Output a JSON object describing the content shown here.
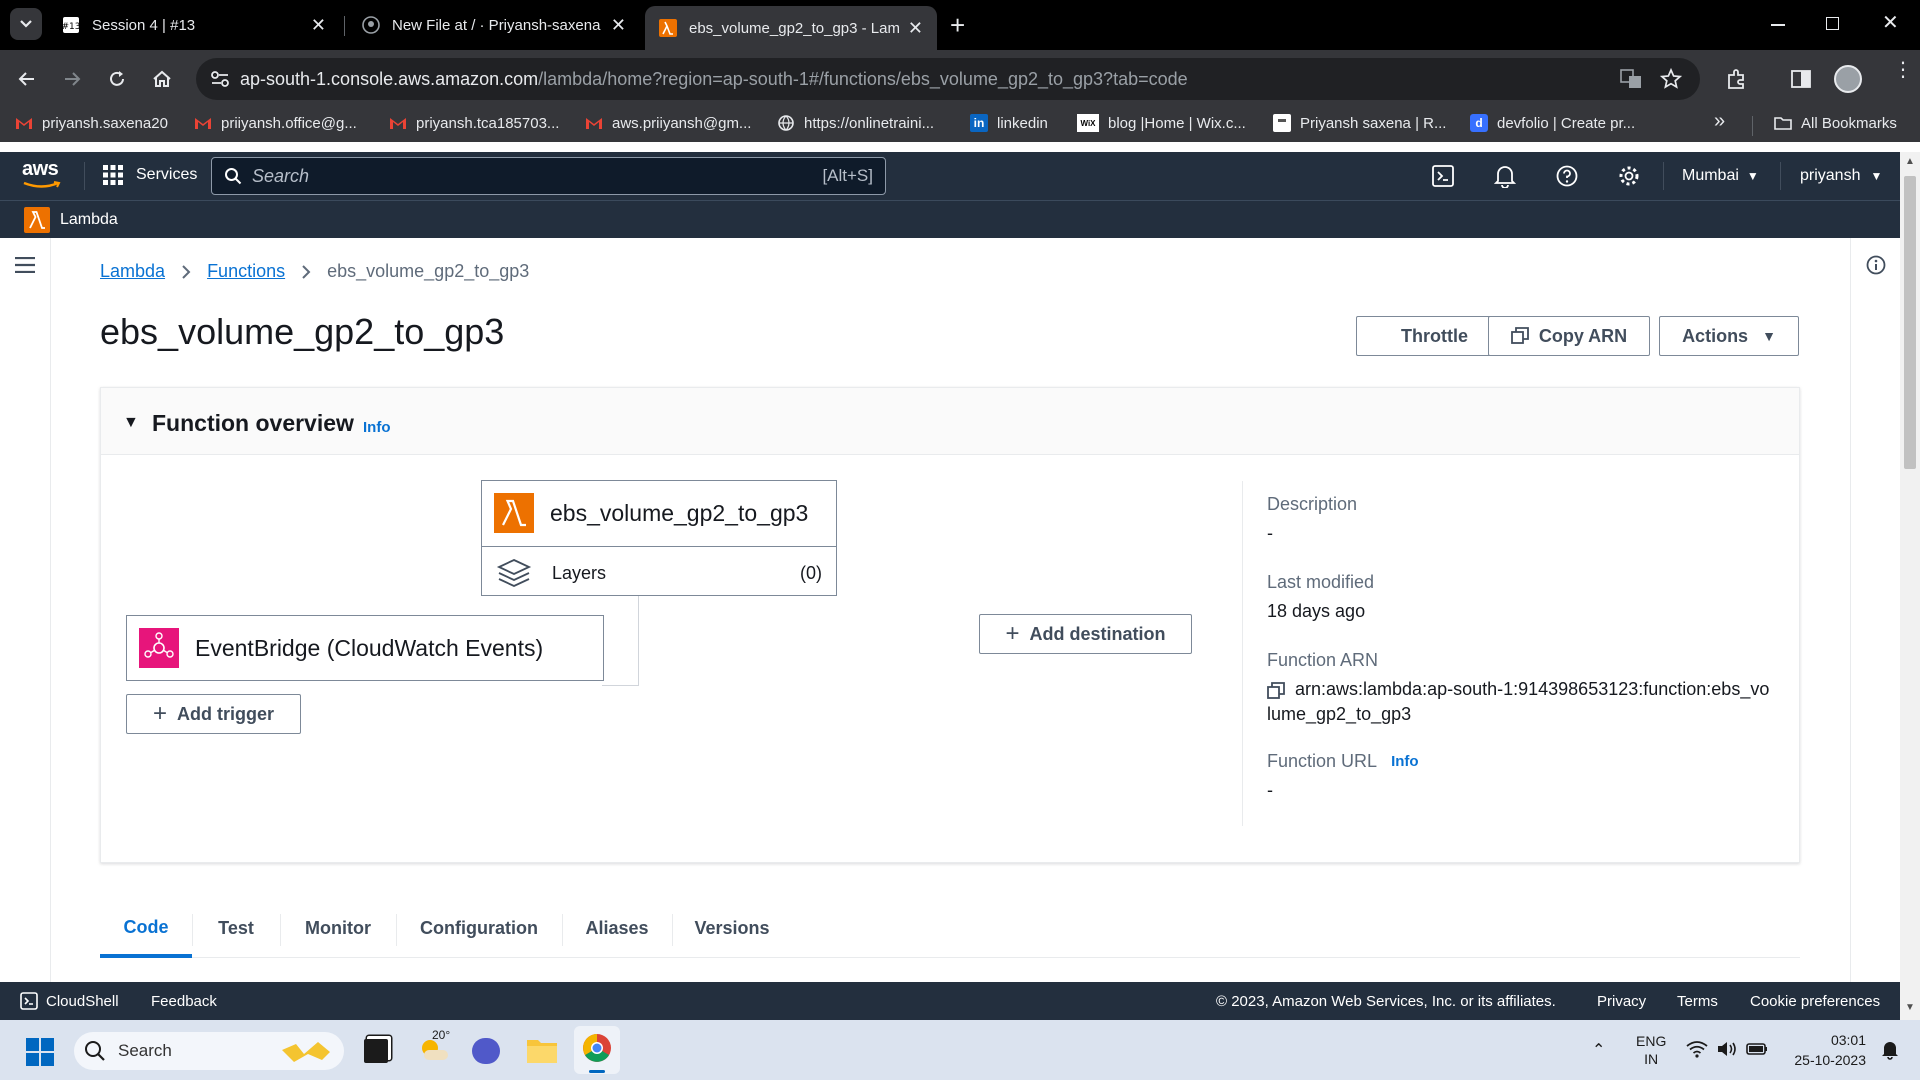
{
  "browser": {
    "tabs": [
      {
        "title": "Session 4 | #13",
        "favicon": "zoom-badge-icon"
      },
      {
        "title": "New File at / · Priyansh-saxena",
        "favicon": "github-icon"
      },
      {
        "title": "ebs_volume_gp2_to_gp3 - Lam",
        "favicon": "lambda-icon"
      }
    ],
    "new_tab": "+",
    "url_host": "ap-south-1.console.aws.amazon.com",
    "url_path": "/lambda/home?region=ap-south-1#/functions/ebs_volume_gp2_to_gp3?tab=code",
    "bookmarks": [
      {
        "label": "priyansh.saxena20",
        "icon": "gmail-icon"
      },
      {
        "label": "priiyansh.office@g...",
        "icon": "gmail-icon"
      },
      {
        "label": "priyansh.tca185703...",
        "icon": "gmail-icon"
      },
      {
        "label": "aws.priiyansh@gm...",
        "icon": "gmail-icon"
      },
      {
        "label": "https://onlinetraini...",
        "icon": "globe-icon"
      },
      {
        "label": "linkedin",
        "icon": "linkedin-icon"
      },
      {
        "label": "blog |Home | Wix.c...",
        "icon": "wix-icon"
      },
      {
        "label": "Priyansh saxena | R...",
        "icon": "page-icon"
      },
      {
        "label": "devfolio | Create pr...",
        "icon": "devfolio-icon"
      }
    ],
    "all_bookmarks": "All Bookmarks"
  },
  "aws": {
    "logo": "aws",
    "services": "Services",
    "search_placeholder": "Search",
    "search_shortcut": "[Alt+S]",
    "region": "Mumbai",
    "user": "priyansh",
    "service_name": "Lambda"
  },
  "breadcrumb": {
    "root": "Lambda",
    "section": "Functions",
    "current": "ebs_volume_gp2_to_gp3"
  },
  "page": {
    "title": "ebs_volume_gp2_to_gp3",
    "throttle": "Throttle",
    "copy_arn": "Copy ARN",
    "actions": "Actions"
  },
  "overview": {
    "heading": "Function overview",
    "info": "Info",
    "function_name": "ebs_volume_gp2_to_gp3",
    "layers_label": "Layers",
    "layers_count": "(0)",
    "trigger_name": "EventBridge (CloudWatch Events)",
    "add_trigger": "Add trigger",
    "add_destination": "Add destination",
    "description_label": "Description",
    "description_value": "-",
    "last_modified_label": "Last modified",
    "last_modified_value": "18 days ago",
    "arn_label": "Function ARN",
    "arn_line1": "arn:aws:lambda:ap-south-1:914398653123:function:ebs_vo",
    "arn_line2": "lume_gp2_to_gp3",
    "url_label": "Function URL",
    "url_info": "Info",
    "url_value": "-"
  },
  "code_tabs": [
    "Code",
    "Test",
    "Monitor",
    "Configuration",
    "Aliases",
    "Versions"
  ],
  "footer": {
    "cloudshell": "CloudShell",
    "feedback": "Feedback",
    "copyright": "© 2023, Amazon Web Services, Inc. or its affiliates.",
    "privacy": "Privacy",
    "terms": "Terms",
    "cookies": "Cookie preferences"
  },
  "taskbar": {
    "search": "Search",
    "weather": "20°",
    "lang1": "ENG",
    "lang2": "IN",
    "time": "03:01",
    "date": "25-10-2023"
  },
  "colors": {
    "aws_nav": "#232f3e",
    "link": "#0972d3",
    "lambda_orange": "#ed7100",
    "eventbridge_pink": "#e7157b"
  }
}
